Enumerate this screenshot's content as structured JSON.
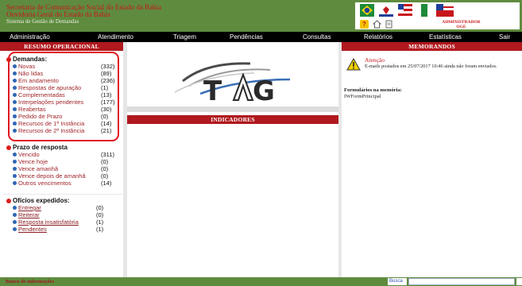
{
  "header": {
    "org_line1": "Secretaria de Comunicação Social do Estado da Bahia",
    "org_line2": "Ouvidoria Geral do Estado da Bahia",
    "system_name": "Sistema de Gestão de Demandas",
    "user_role": "ADMINISTRADOR",
    "user_unit": "OGE",
    "icons": [
      "help-icon",
      "home-icon",
      "document-icon"
    ]
  },
  "menu": {
    "items": [
      "Administração",
      "Atendimento",
      "Triagem",
      "Pendências",
      "Consultas",
      "Relatórios",
      "Estatísticas",
      "Sair"
    ]
  },
  "left": {
    "title": "RESUMO OPERACIONAL",
    "demandas": {
      "label": "Demandas:",
      "items": [
        {
          "label": "Novas",
          "count": "(332)"
        },
        {
          "label": "Não lidas",
          "count": "(89)"
        },
        {
          "label": "Em andamento",
          "count": "(236)"
        },
        {
          "label": "Respostas de apuração",
          "count": "(1)"
        },
        {
          "label": "Complementadas",
          "count": "(13)"
        },
        {
          "label": "Interpelações pendentes",
          "count": "(177)"
        },
        {
          "label": "Reabertas",
          "count": "(30)"
        },
        {
          "label": "Pedido de Prazo",
          "count": "(0)"
        },
        {
          "label": "Recursos de 1ª Instância",
          "count": "(14)"
        },
        {
          "label": "Recursos de 2ª Instância",
          "count": "(21)"
        }
      ]
    },
    "prazo": {
      "label": "Prazo de resposta",
      "items": [
        {
          "label": "Vencido",
          "count": "(311)"
        },
        {
          "label": "Vence hoje",
          "count": "(0)"
        },
        {
          "label": "Vence amanhã",
          "count": "(0)"
        },
        {
          "label": "Vence depois de amanhã",
          "count": "(0)"
        },
        {
          "label": "Outros vencimentos",
          "count": "(14)"
        }
      ]
    },
    "oficios": {
      "label": "Ofícios expedidos:",
      "items": [
        {
          "label": "Entregar",
          "count": "(0)"
        },
        {
          "label": "Reiterar",
          "count": "(0)"
        },
        {
          "label": "Resposta insatisfatória",
          "count": "(1)"
        },
        {
          "label": "Pendentes",
          "count": "(1)"
        }
      ]
    }
  },
  "middle": {
    "logo_text": "TAG",
    "indicators_title": "INDICADORES"
  },
  "right": {
    "title": "MEMORANDOS",
    "alert_title": "Atenção",
    "alert_text": "E-mails postados em 25/07/2017 10:46 ainda não foram enviados.",
    "forms_title": "Formulários na memória:",
    "forms_item": "IWFormPrincipal"
  },
  "footer": {
    "left_label": "Banco de informações",
    "search_label": "Busca",
    "search_value": ""
  },
  "colors": {
    "header_green": "#5f8b3e",
    "accent_red": "#b0191e",
    "link_red": "#a1262b",
    "bullet_blue": "#2f66b3"
  }
}
